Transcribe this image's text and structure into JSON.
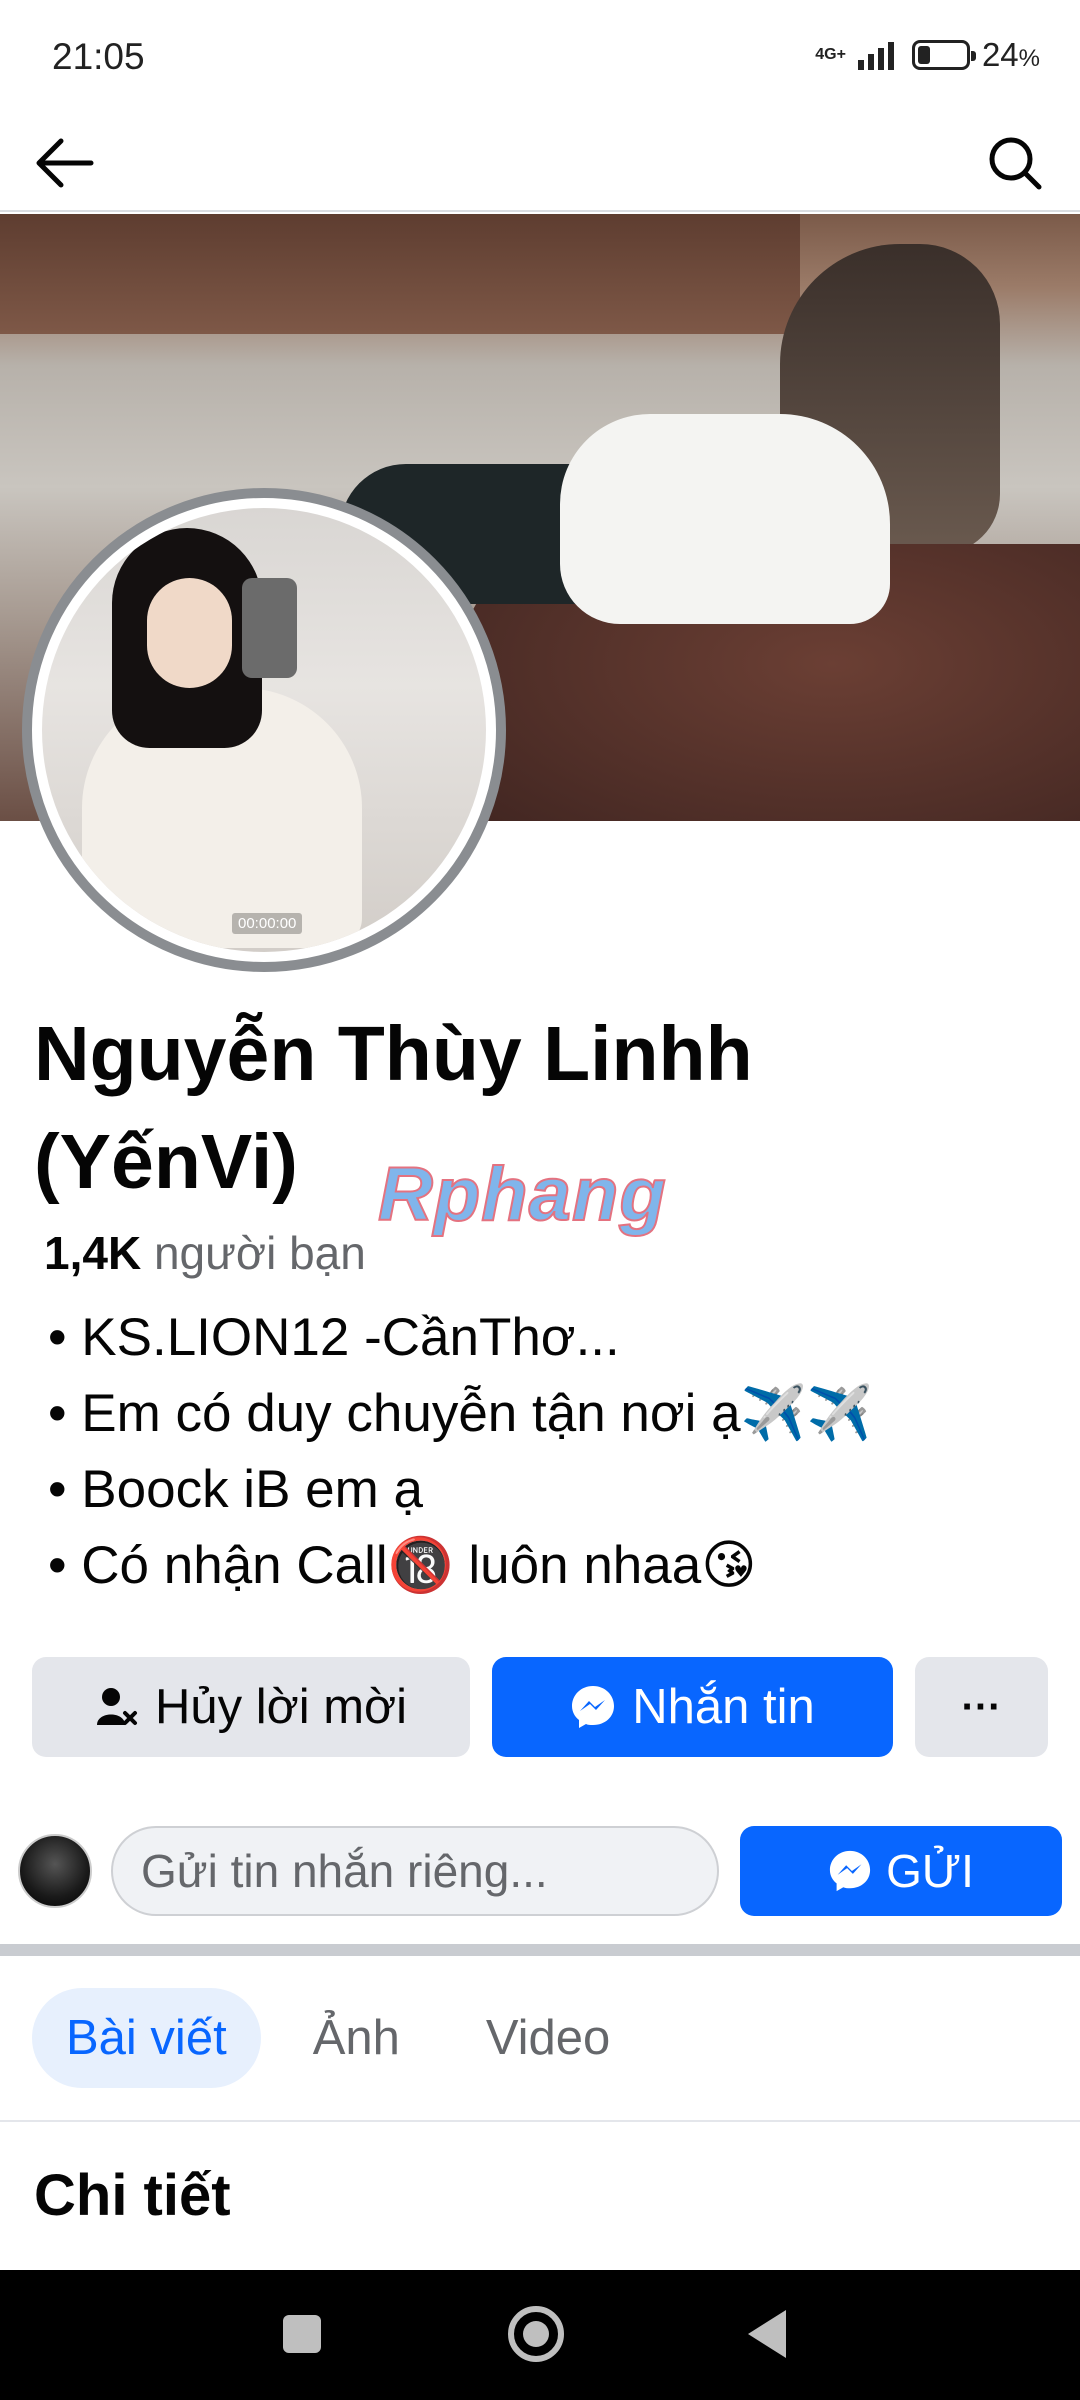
{
  "status_bar": {
    "time": "21:05",
    "network": "4G+",
    "battery_percent": "24",
    "battery_unit": "%"
  },
  "nav": {
    "back_icon": "arrow-left-icon",
    "search_icon": "search-icon"
  },
  "profile": {
    "name_line1": "Nguyễn Thùy Linhh",
    "name_line2": "(YếnVi)",
    "avatar_video_time": "00:00:00",
    "watermark": "Rphang",
    "friends_count": "1,4K",
    "friends_label": "người bạn",
    "bio": [
      "• KS.LION12 -CầnThơ...",
      "• Em có duy chuyễn tận nơi ạ✈️✈️",
      "• Boock iB em ạ",
      "• Có nhận Call🔞 luôn nhaa😘"
    ]
  },
  "actions": {
    "cancel_request_label": "Hủy lời mời",
    "message_label": "Nhắn tin",
    "more_label": "···"
  },
  "private_message": {
    "placeholder": "Gửi tin nhắn riêng...",
    "send_label": "GỬI"
  },
  "tabs": [
    {
      "label": "Bài viết",
      "active": true
    },
    {
      "label": "Ảnh",
      "active": false
    },
    {
      "label": "Video",
      "active": false
    }
  ],
  "section": {
    "title": "Chi tiết"
  },
  "colors": {
    "primary": "#0866ff",
    "secondary_button": "#e4e6eb",
    "text_secondary": "#65676b"
  }
}
